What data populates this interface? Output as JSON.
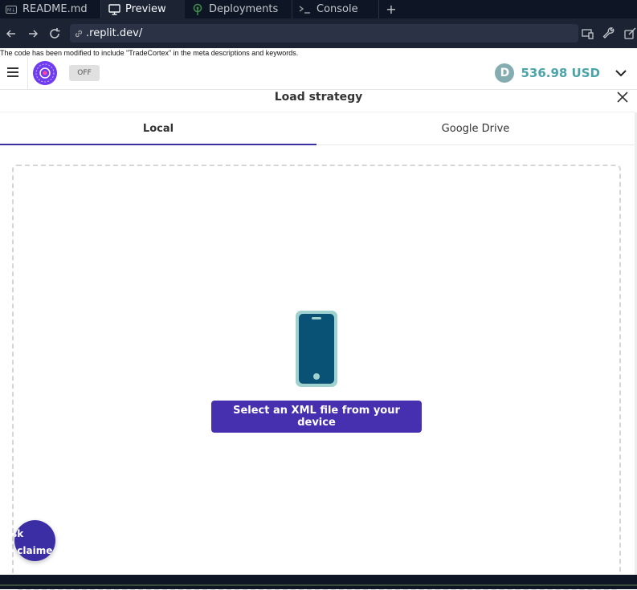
{
  "browser": {
    "tabs": [
      {
        "label": "README.md",
        "icon": "markdown-icon",
        "active": false
      },
      {
        "label": "Preview",
        "icon": "monitor-icon",
        "active": true
      },
      {
        "label": "Deployments",
        "icon": "deploy-icon",
        "active": false
      },
      {
        "label": "Console",
        "icon": "terminal-icon",
        "active": false
      }
    ],
    "new_tab_label": "+",
    "url": ".replit.dev/"
  },
  "notice": "The code has been modified to include \"TradeCortex\" in the meta descriptions and keywords.",
  "header": {
    "toggle_label": "OFF",
    "balance": "536.98 USD",
    "balance_icon_letter": "D",
    "colors": {
      "accent": "#4630b0",
      "balance": "#4ba4a8"
    }
  },
  "modal": {
    "title": "Load strategy",
    "tabs": [
      {
        "label": "Local",
        "active": true
      },
      {
        "label": "Google Drive",
        "active": false
      }
    ],
    "select_button": "Select an XML file from your device"
  },
  "risk_button": {
    "line1": "isk",
    "line2": "isclaime"
  }
}
